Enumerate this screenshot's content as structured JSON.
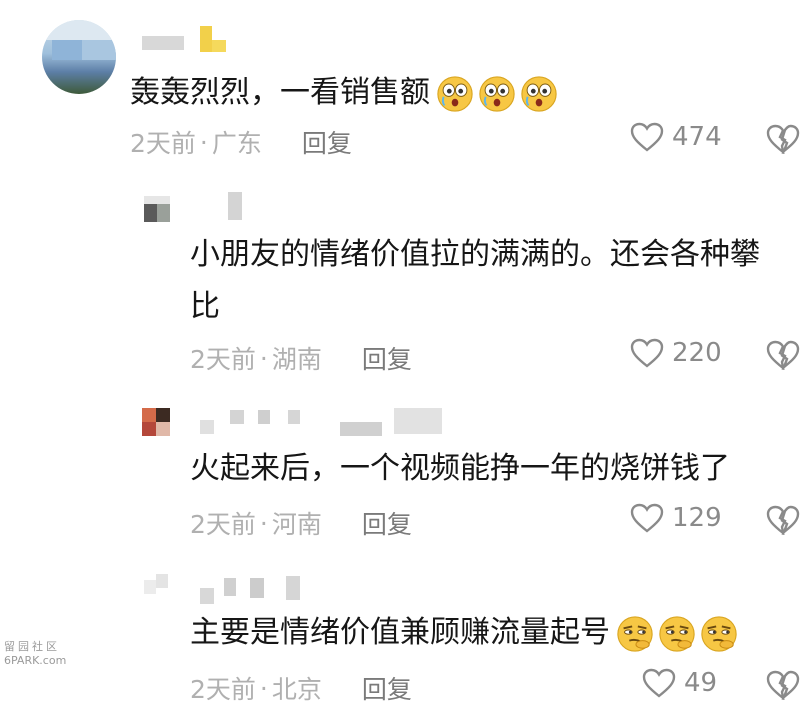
{
  "comments": [
    {
      "text": "轰轰烈烈，一看销售额",
      "time": "2天前",
      "location": "广东",
      "reply_label": "回复",
      "likes": "474",
      "emoji": "surprised-face",
      "emoji_count": 3
    },
    {
      "text_line1": "小朋友的情绪价值拉的满满的。还会各种攀",
      "text_line2": "比",
      "time": "2天前",
      "location": "湖南",
      "reply_label": "回复",
      "likes": "220"
    },
    {
      "text": "火起来后，一个视频能挣一年的烧饼钱了",
      "time": "2天前",
      "location": "河南",
      "reply_label": "回复",
      "likes": "129"
    },
    {
      "text": "主要是情绪价值兼顾赚流量起号",
      "time": "2天前",
      "location": "北京",
      "reply_label": "回复",
      "likes": "49",
      "emoji": "smirk-face",
      "emoji_count": 3
    }
  ],
  "separator": "·",
  "watermark": {
    "line1": "留园社区",
    "line2": "6PARK.com"
  },
  "colors": {
    "text": "#161616",
    "meta": "#b0b0b0",
    "reply": "#7a7a7a",
    "likes": "#8a8a8a",
    "emoji": "#f7c744"
  }
}
